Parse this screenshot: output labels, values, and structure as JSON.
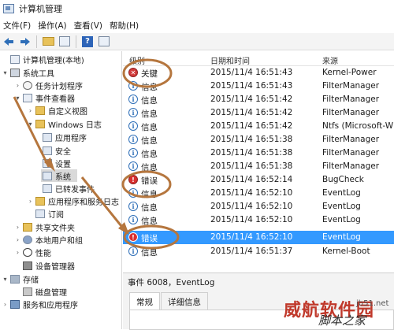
{
  "window": {
    "title": "计算机管理"
  },
  "menu": [
    {
      "label": "文件(F)"
    },
    {
      "label": "操作(A)"
    },
    {
      "label": "查看(V)"
    },
    {
      "label": "帮助(H)"
    }
  ],
  "toolbar": {
    "back_icon": "arrow-left-icon",
    "forward_icon": "arrow-right-icon",
    "up_icon": "folder-up-icon",
    "console_icon": "console-tree-icon",
    "help_icon": "help-icon",
    "help_glyph": "?",
    "panel_icon": "panel-icon"
  },
  "tree": {
    "items": [
      {
        "label": "计算机管理(本地)",
        "icon": "computer-icon"
      },
      {
        "label": "系统工具",
        "icon": "tools-icon"
      },
      {
        "label": "任务计划程序",
        "icon": "clock-icon"
      },
      {
        "label": "事件查看器",
        "icon": "event-viewer-icon"
      },
      {
        "label": "自定义视图",
        "icon": "folder-icon"
      },
      {
        "label": "Windows 日志",
        "icon": "folder-icon"
      },
      {
        "label": "应用程序",
        "icon": "log-icon"
      },
      {
        "label": "安全",
        "icon": "log-icon"
      },
      {
        "label": "设置",
        "icon": "log-icon"
      },
      {
        "label": "系统",
        "icon": "log-icon"
      },
      {
        "label": "已转发事件",
        "icon": "log-icon"
      },
      {
        "label": "应用程序和服务日志",
        "icon": "folder-icon"
      },
      {
        "label": "订阅",
        "icon": "log-icon"
      },
      {
        "label": "共享文件夹",
        "icon": "shared-folder-icon"
      },
      {
        "label": "本地用户和组",
        "icon": "users-icon"
      },
      {
        "label": "性能",
        "icon": "performance-icon"
      },
      {
        "label": "设备管理器",
        "icon": "device-manager-icon"
      },
      {
        "label": "存储",
        "icon": "storage-icon"
      },
      {
        "label": "磁盘管理",
        "icon": "disk-icon"
      },
      {
        "label": "服务和应用程序",
        "icon": "services-icon"
      }
    ]
  },
  "events": {
    "columns": {
      "level": "级别",
      "datetime": "日期和时间",
      "source": "来源"
    },
    "rows": [
      {
        "level": "关键",
        "datetime": "2015/11/4 16:51:43",
        "source": "Kernel-Power"
      },
      {
        "level": "信息",
        "datetime": "2015/11/4 16:51:43",
        "source": "FilterManager"
      },
      {
        "level": "信息",
        "datetime": "2015/11/4 16:51:42",
        "source": "FilterManager"
      },
      {
        "level": "信息",
        "datetime": "2015/11/4 16:51:42",
        "source": "FilterManager"
      },
      {
        "level": "信息",
        "datetime": "2015/11/4 16:51:42",
        "source": "Ntfs (Microsoft-W"
      },
      {
        "level": "信息",
        "datetime": "2015/11/4 16:51:38",
        "source": "FilterManager"
      },
      {
        "level": "信息",
        "datetime": "2015/11/4 16:51:38",
        "source": "FilterManager"
      },
      {
        "level": "信息",
        "datetime": "2015/11/4 16:51:38",
        "source": "FilterManager"
      },
      {
        "level": "错误",
        "datetime": "2015/11/4 16:52:14",
        "source": "BugCheck"
      },
      {
        "level": "信息",
        "datetime": "2015/11/4 16:52:10",
        "source": "EventLog"
      },
      {
        "level": "信息",
        "datetime": "2015/11/4 16:52:10",
        "source": "EventLog"
      },
      {
        "level": "信息",
        "datetime": "2015/11/4 16:52:10",
        "source": "EventLog"
      },
      {
        "level": "错误",
        "datetime": "2015/11/4 16:52:10",
        "source": "EventLog"
      },
      {
        "level": "信息",
        "datetime": "2015/11/4 16:51:37",
        "source": "Kernel-Boot"
      }
    ]
  },
  "detail": {
    "header": "事件 6008，EventLog",
    "tabs": [
      {
        "label": "常规"
      },
      {
        "label": "详细信息"
      }
    ]
  },
  "watermark": {
    "line1": "威航软件园",
    "line2": "脚本之家",
    "line3": "jb51.net"
  },
  "colors": {
    "selection": "#3399ff",
    "annotation": "#b5763e",
    "error": "#d92f2f",
    "info": "#2f6fb8"
  }
}
